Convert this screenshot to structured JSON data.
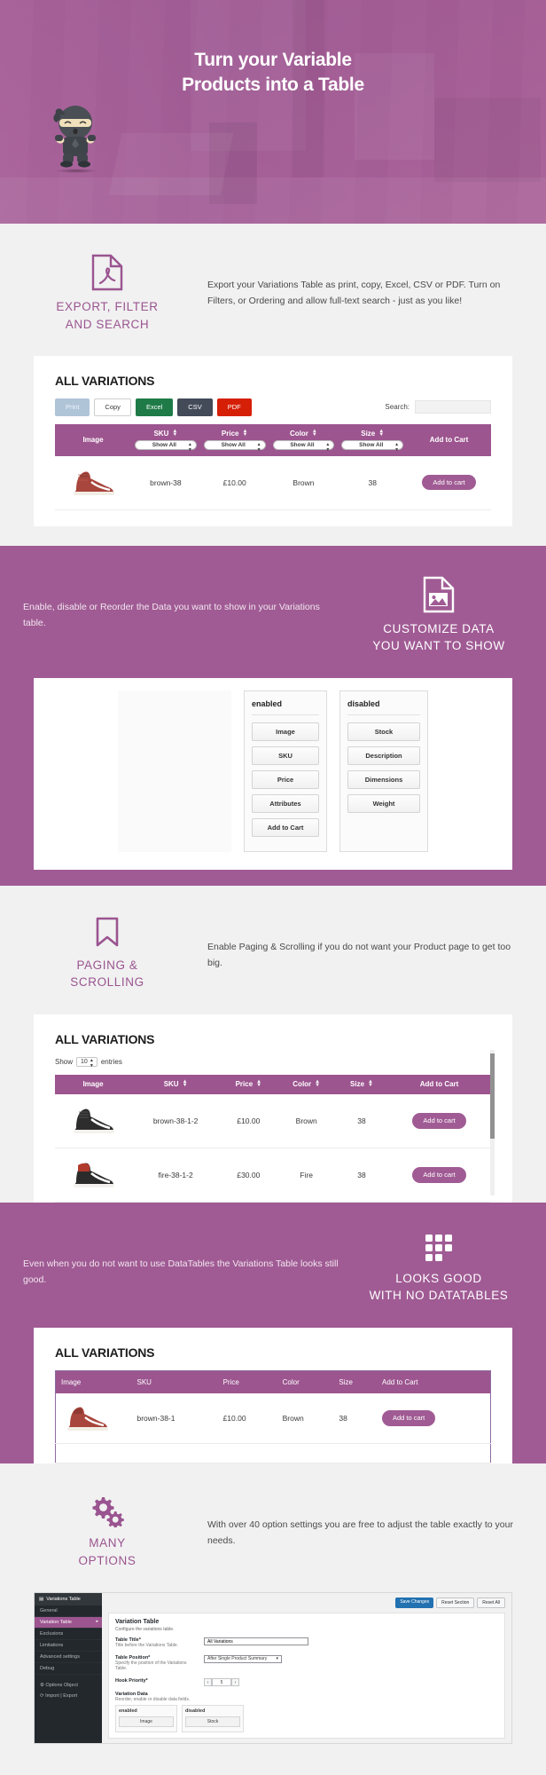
{
  "hero": {
    "title_line1": "Turn your Variable",
    "title_line2": "Products into a Table",
    "mascot": "ninja-mascot"
  },
  "sections": [
    {
      "id": "export-filter-search",
      "icon": "pdf-file-icon",
      "heading_line1": "EXPORT, FILTER",
      "heading_line2": "AND SEARCH",
      "text": "Export your Variations Table as print, copy, Excel, CSV or PDF. Turn on Filters, or Ordering and allow full-text search - just as you like!"
    },
    {
      "id": "customize-data",
      "icon": "image-file-icon",
      "heading_line1": "CUSTOMIZE DATA",
      "heading_line2": "YOU WANT TO SHOW",
      "text": "Enable, disable or Reorder the Data you want to show in your Variations table."
    },
    {
      "id": "paging-scrolling",
      "icon": "bookmark-icon",
      "heading_line1": "PAGING &",
      "heading_line2": "SCROLLING",
      "text": "Enable Paging & Scrolling if you do not want your Product page to get too big."
    },
    {
      "id": "no-datatables",
      "icon": "grid-icon",
      "heading_line1": "LOOKS GOOD",
      "heading_line2": "WITH NO DATATABLES",
      "text": "Even when you do not want to use DataTables the Variations Table looks still good."
    },
    {
      "id": "many-options",
      "icon": "gears-icon",
      "heading_line1": "MANY",
      "heading_line2": "OPTIONS",
      "text": "With over 40 option settings you are free to adjust the table exactly to your needs."
    }
  ],
  "table1": {
    "title": "ALL VARIATIONS",
    "export_buttons": [
      "Print",
      "Copy",
      "Excel",
      "CSV",
      "PDF"
    ],
    "search_label": "Search:",
    "search_value": "",
    "search_placeholder": "",
    "columns": [
      "Image",
      "SKU",
      "Price",
      "Color",
      "Size",
      "Add to Cart"
    ],
    "filter_placeholder": "Show All",
    "rows": [
      {
        "image": "red-high-top-sneaker",
        "sku": "brown-38",
        "price": "£10.00",
        "color": "Brown",
        "size": "38",
        "cart": "Add to cart"
      }
    ]
  },
  "dnd": {
    "enabled_title": "enabled",
    "disabled_title": "disabled",
    "enabled_items": [
      "Image",
      "SKU",
      "Price",
      "Attributes",
      "Add to Cart"
    ],
    "disabled_items": [
      "Stock",
      "Description",
      "Dimensions",
      "Weight"
    ]
  },
  "table2": {
    "title": "ALL VARIATIONS",
    "show_label": "Show",
    "entries_value": "10",
    "entries_label": "entries",
    "columns": [
      "Image",
      "SKU",
      "Price",
      "Color",
      "Size",
      "Add to Cart"
    ],
    "rows": [
      {
        "image": "black-white-high-top-sneaker",
        "sku": "brown-38-1-2",
        "price": "£10.00",
        "color": "Brown",
        "size": "38",
        "cart": "Add to cart"
      },
      {
        "image": "black-red-high-top-sneaker",
        "sku": "fire-38-1-2",
        "price": "£30.00",
        "color": "Fire",
        "size": "38",
        "cart": "Add to cart"
      }
    ]
  },
  "table3": {
    "title": "ALL VARIATIONS",
    "columns": [
      "Image",
      "SKU",
      "Price",
      "Color",
      "Size",
      "Add to Cart"
    ],
    "rows": [
      {
        "image": "red-high-top-sneaker",
        "sku": "brown-38-1",
        "price": "£10.00",
        "color": "Brown",
        "size": "38",
        "cart": "Add to cart"
      }
    ]
  },
  "wp": {
    "sidebar_title": "Variations Table",
    "sidebar_items": [
      "General",
      "Variation Table",
      "Exclusions",
      "Limitations",
      "Advanced settings",
      "Debug"
    ],
    "sidebar_active": "Variation Table",
    "sidebar_extra": [
      "Options Object",
      "Import | Export"
    ],
    "buttons": {
      "save": "Save Changes",
      "reset_section": "Reset Section",
      "reset_all": "Reset All"
    },
    "panel_title": "Variation Table",
    "panel_sub": "Configure the variations table.",
    "fields": [
      {
        "label": "Table Title*",
        "desc": "Title before the Variations Table.",
        "value": "All Variations",
        "type": "text"
      },
      {
        "label": "Table Position*",
        "desc": "Specify the position of the Variations Table.",
        "value": "After Single Product Summary",
        "type": "select"
      },
      {
        "label": "Hook Priority*",
        "desc": "",
        "value": "5",
        "type": "number"
      },
      {
        "label": "Variation Data",
        "desc": "Reorder, enable or disable data fields.",
        "value": "",
        "type": "dnd"
      }
    ],
    "dnd_enabled_title": "enabled",
    "dnd_disabled_title": "disabled",
    "dnd_enabled": [
      "Image"
    ],
    "dnd_disabled": [
      "Stock"
    ]
  },
  "colors": {
    "purple": "#a05b94",
    "purple_dark": "#9c558f",
    "light_bg": "#f1f1f1",
    "white": "#ffffff",
    "excel_green": "#1e7b47",
    "csv_slate": "#434a58",
    "pdf_red": "#d61f07",
    "print_blue": "#b0c4d8"
  }
}
